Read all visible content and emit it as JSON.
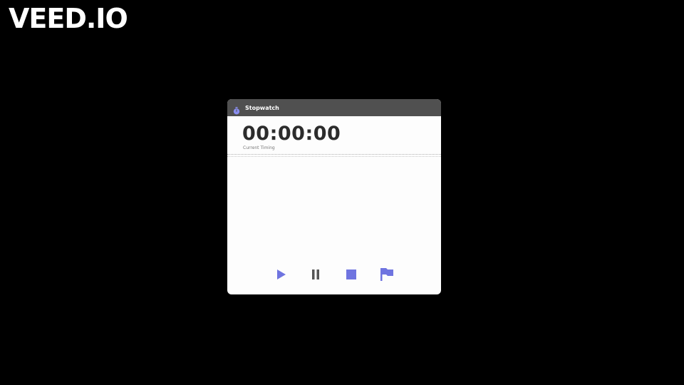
{
  "watermark": {
    "text": "VEED.IO"
  },
  "window": {
    "title": "Stopwatch",
    "icon": "stopwatch-icon"
  },
  "stopwatch": {
    "time": "00:00:00",
    "label": "Current Timing"
  },
  "controls": {
    "play": {
      "icon": "play-icon"
    },
    "pause": {
      "icon": "pause-icon"
    },
    "stop": {
      "icon": "stop-icon"
    },
    "lap": {
      "icon": "flag-icon"
    }
  },
  "colors": {
    "background": "#000000",
    "titlebar": "#505050",
    "window": "#fdfdfd",
    "accent": "#6f74e0",
    "pause": "#555555",
    "time_text": "#2c2c2c"
  }
}
